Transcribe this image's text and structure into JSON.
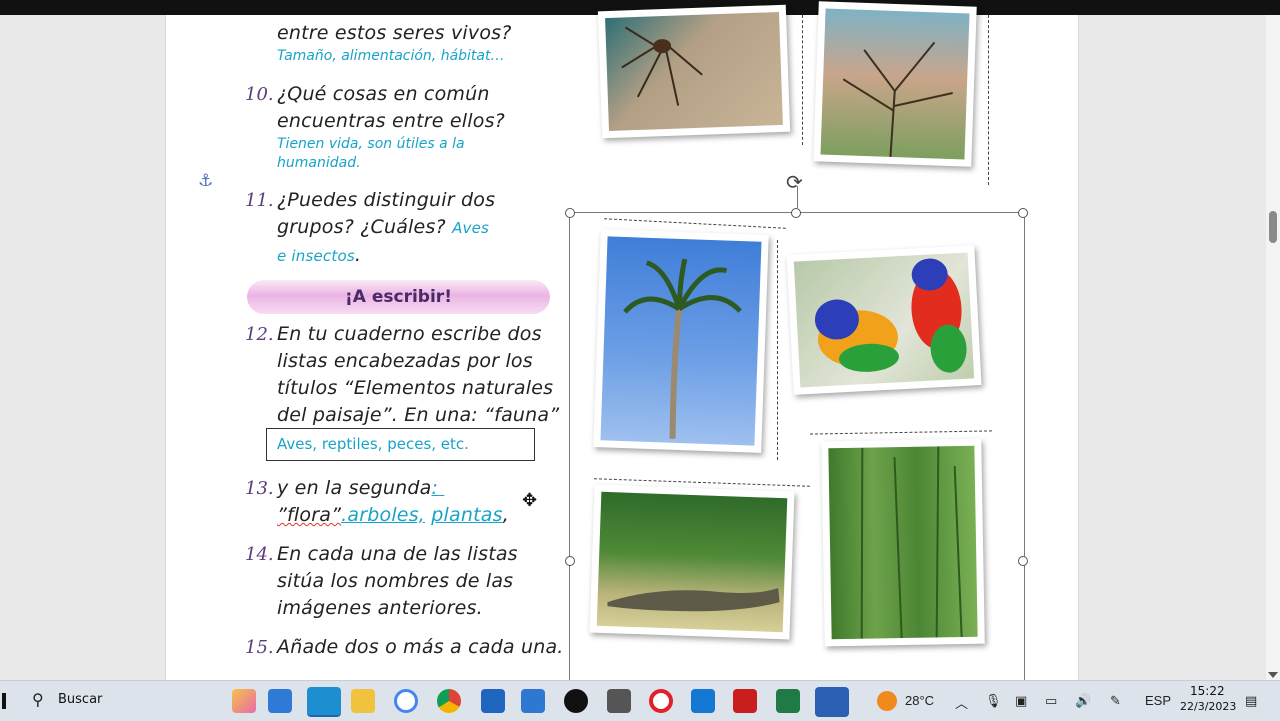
{
  "questions": {
    "q9_line": "entre estos seres vivos?",
    "q9_answer": "Tamaño, alimentación, hábitat…",
    "q10_num": "10.",
    "q10_line1": "¿Qué cosas en común",
    "q10_line2": "encuentras entre ellos?",
    "q10_answer1": "Tienen vida, son útiles a la",
    "q10_answer2": "humanidad.",
    "q11_num": "11.",
    "q11_line1": "¿Puedes distinguir dos",
    "q11_line2": "grupos? ¿Cuáles?",
    "q11_answer1": "Aves",
    "q11_answer2": "e insectos",
    "banner": "¡A escribir!",
    "q12_num": "12.",
    "q12_line1": "En tu cuaderno escribe dos",
    "q12_line2": "listas encabezadas por los",
    "q12_line3": "títulos “Elementos naturales",
    "q12_line4": "del paisaje”. En una: “fauna”",
    "q12_answer": "Aves, reptiles, peces, etc.",
    "q13_num": "13.",
    "q13_line1": "y en la segunda",
    "q13_colon": ":",
    "q13_flora": "”flora”",
    "q13_arboles": ".arboles,",
    "q13_plantas": "plantas",
    "q13_comma": ",",
    "q14_num": "14.",
    "q14_line1": "En cada una de las listas",
    "q14_line2": "sitúa los nombres de las",
    "q14_line3": "imágenes anteriores.",
    "q15_num": "15.",
    "q15_line1": "Añade dos o más a cada una."
  },
  "taskbar": {
    "search_label": "Buscar",
    "weather": "28°C",
    "language": "ESP",
    "time": "15:22",
    "date": "22/3/2023"
  },
  "colors": {
    "answer": "#18a3c8",
    "number": "#5c3b78",
    "banner": "#eab4e3"
  }
}
